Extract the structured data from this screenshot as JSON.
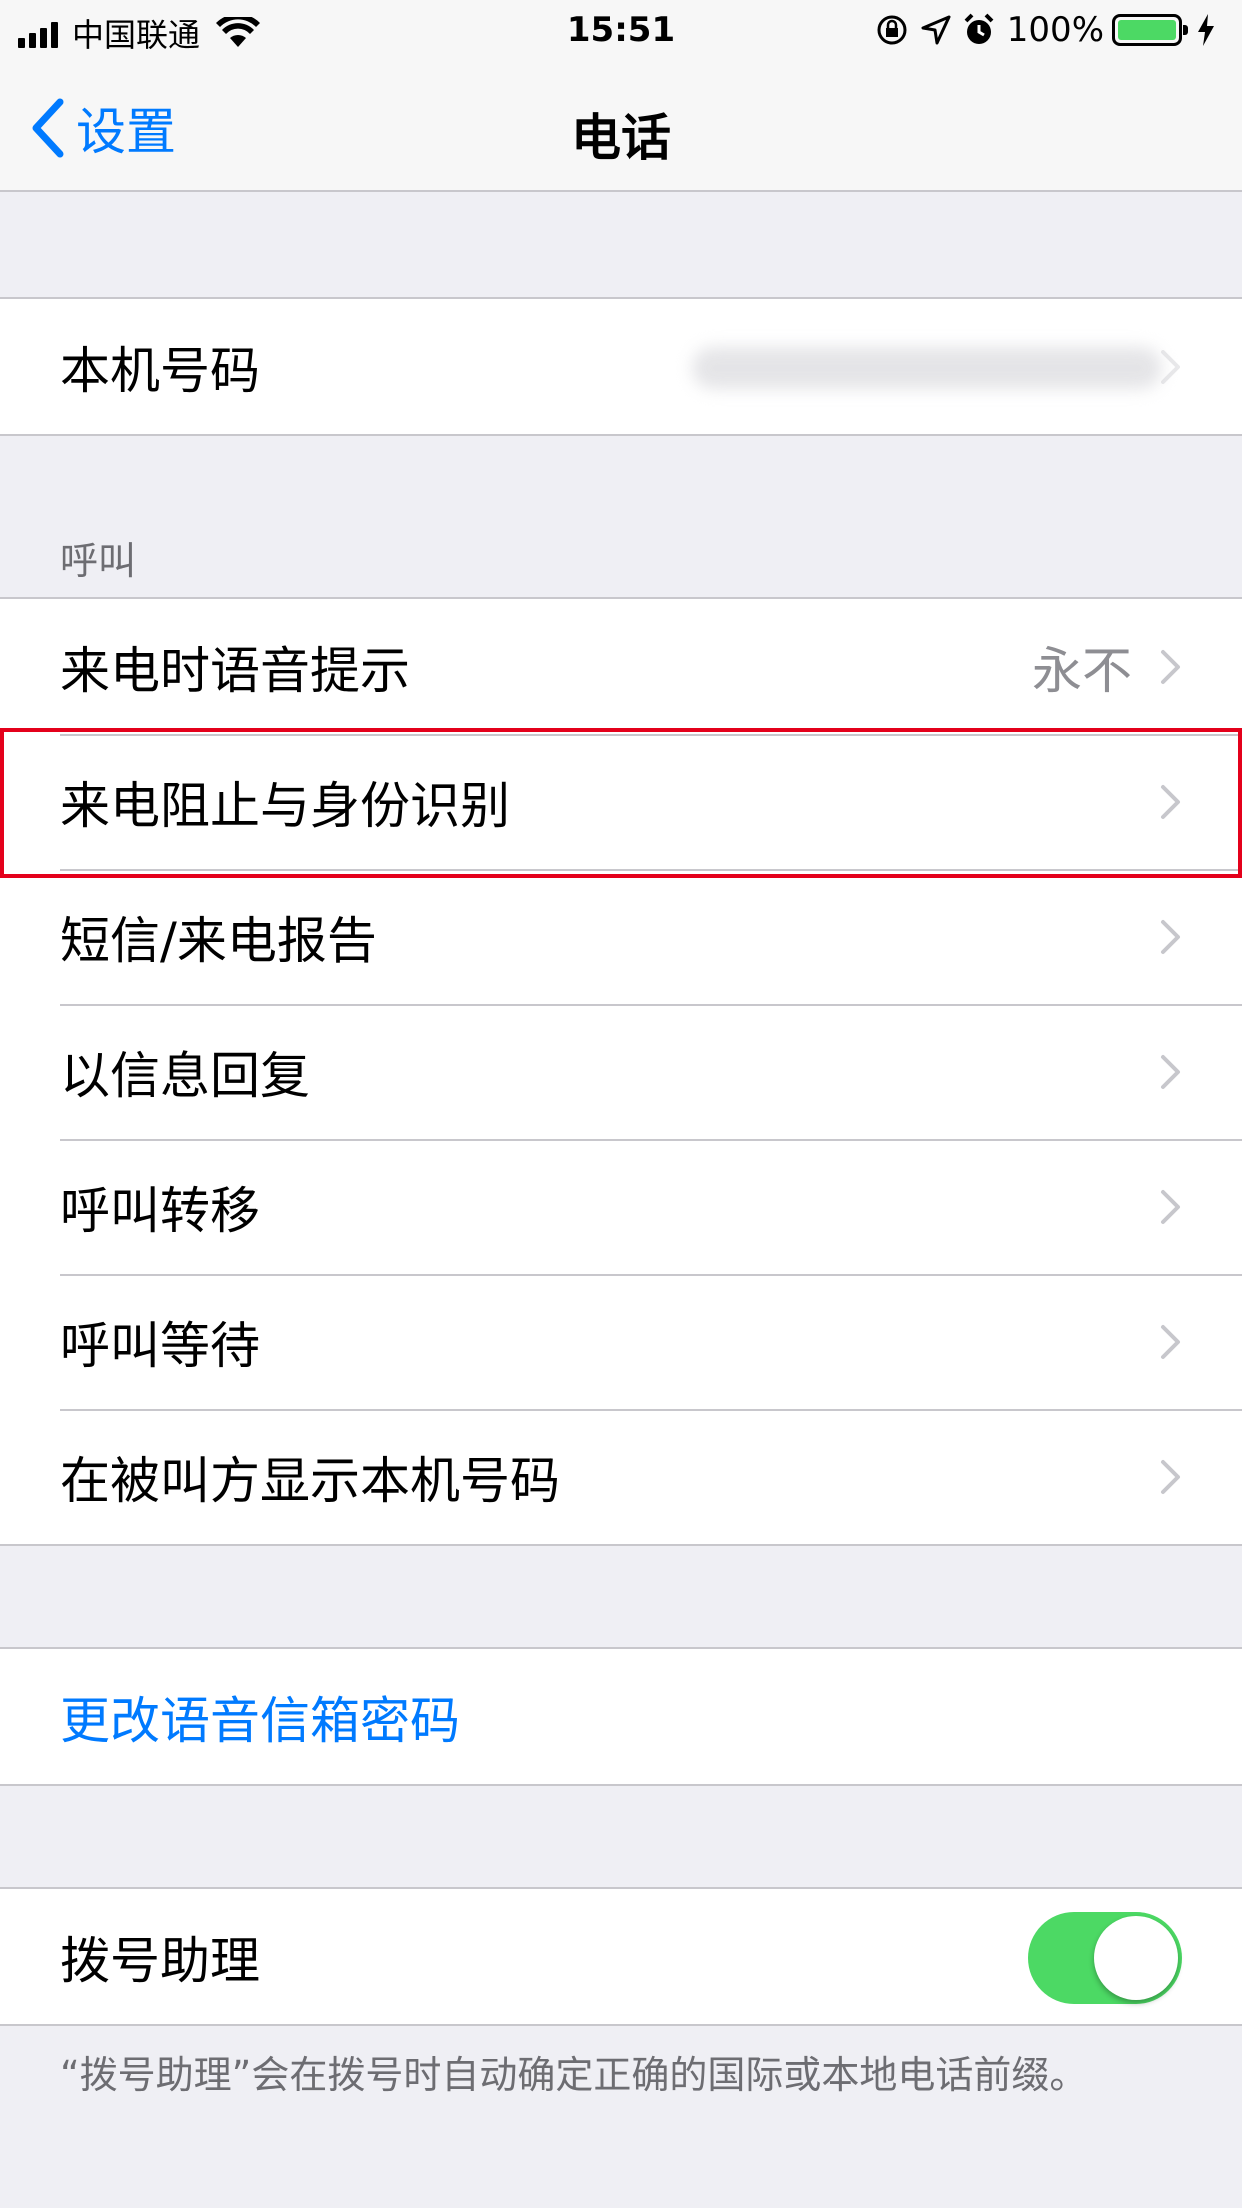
{
  "status_bar": {
    "carrier": "中国联通",
    "time": "15:51",
    "battery": "100%"
  },
  "nav": {
    "back_label": "设置",
    "title": "电话"
  },
  "my_number": {
    "label": "本机号码"
  },
  "calls_section": {
    "header": "呼叫",
    "rows": [
      {
        "label": "来电时语音提示",
        "value": "永不"
      },
      {
        "label": "来电阻止与身份识别",
        "value": ""
      },
      {
        "label": "短信/来电报告",
        "value": ""
      },
      {
        "label": "以信息回复",
        "value": ""
      },
      {
        "label": "呼叫转移",
        "value": ""
      },
      {
        "label": "呼叫等待",
        "value": ""
      },
      {
        "label": "在被叫方显示本机号码",
        "value": ""
      }
    ]
  },
  "voicemail": {
    "label": "更改语音信箱密码"
  },
  "dial_assist": {
    "label": "拨号助理",
    "enabled": true,
    "footer": "“拨号助理”会在拨号时自动确定正确的国际或本地电话前缀。"
  },
  "colors": {
    "accent": "#007aff",
    "toggle_on": "#4cd964",
    "highlight": "#e4001b"
  }
}
